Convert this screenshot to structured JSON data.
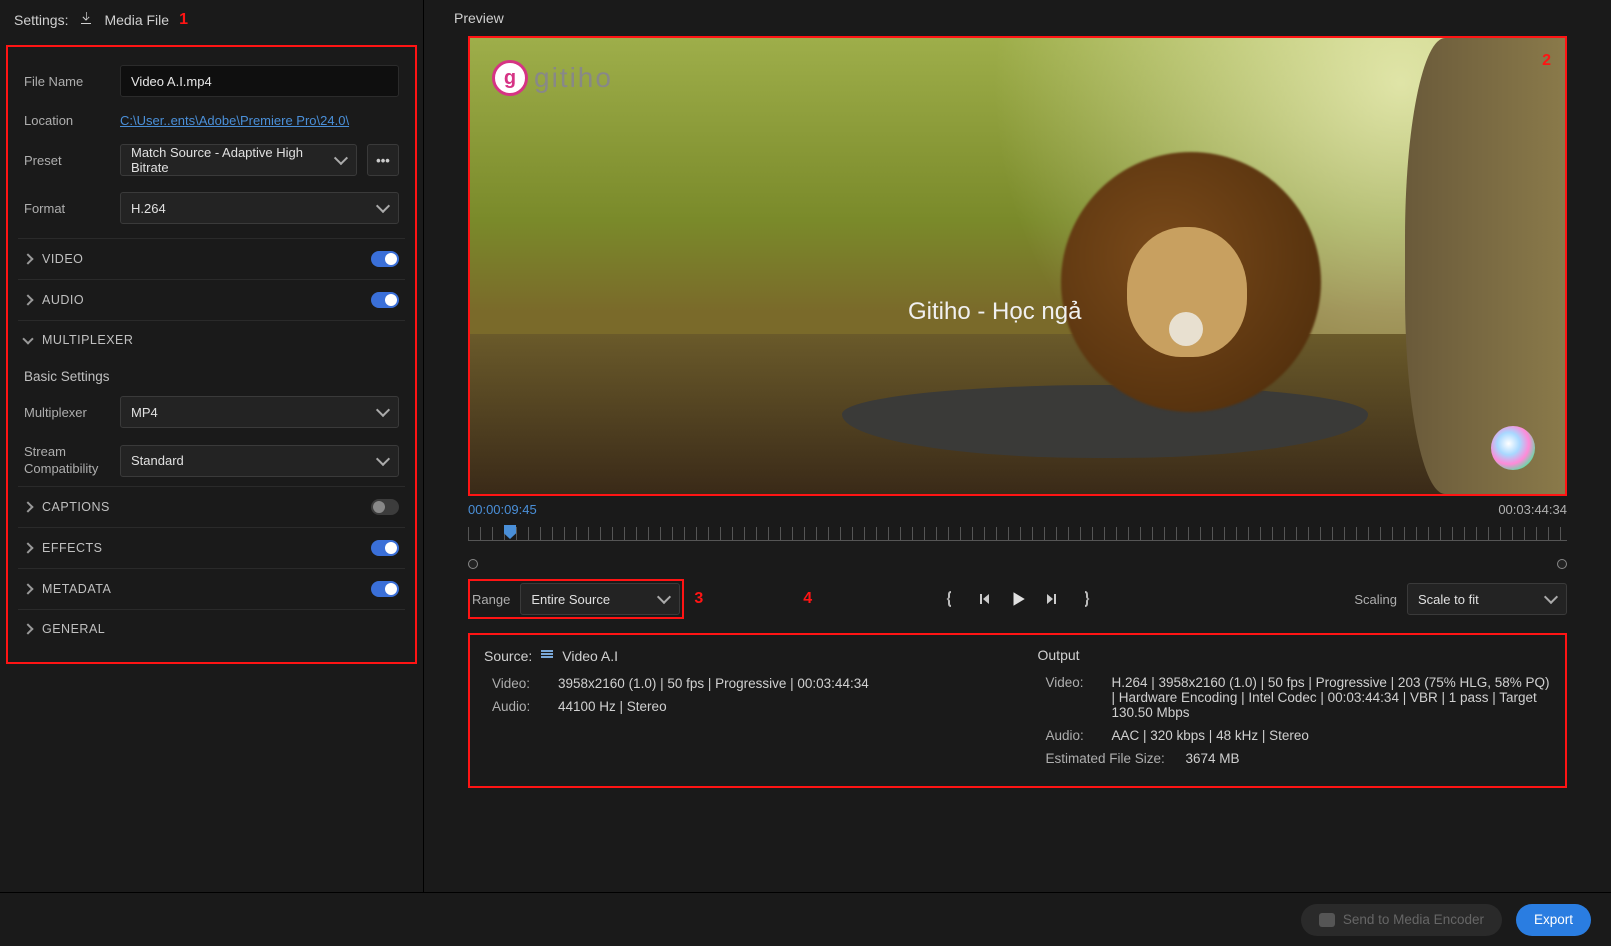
{
  "header": {
    "settings_label": "Settings:",
    "media_file_label": "Media File",
    "marker_1": "1"
  },
  "settings": {
    "file_name_label": "File Name",
    "file_name_value": "Video A.I.mp4",
    "location_label": "Location",
    "location_value": "C:\\User..ents\\Adobe\\Premiere Pro\\24.0\\",
    "preset_label": "Preset",
    "preset_value": "Match Source - Adaptive High Bitrate",
    "format_label": "Format",
    "format_value": "H.264",
    "sections": {
      "video": "VIDEO",
      "audio": "AUDIO",
      "multiplexer": "MULTIPLEXER",
      "captions": "CAPTIONS",
      "effects": "EFFECTS",
      "metadata": "METADATA",
      "general": "GENERAL"
    },
    "basic_settings_label": "Basic Settings",
    "multiplexer_field_label": "Multiplexer",
    "multiplexer_value": "MP4",
    "stream_compat_label": "Stream Compatibility",
    "stream_compat_value": "Standard"
  },
  "preview": {
    "header": "Preview",
    "marker_2": "2",
    "overlay_text": "Gitiho - Học ngả",
    "logo_text": "gitiho",
    "time_start": "00:00:09:45",
    "time_end": "00:03:44:34"
  },
  "controls": {
    "range_label": "Range",
    "range_value": "Entire Source",
    "marker_3": "3",
    "scaling_label": "Scaling",
    "scaling_value": "Scale to fit"
  },
  "summary": {
    "marker_4": "4",
    "source_label": "Source:",
    "source_name": "Video A.I",
    "source_video_label": "Video:",
    "source_video_value": "3958x2160 (1.0) | 50 fps | Progressive | 00:03:44:34",
    "source_audio_label": "Audio:",
    "source_audio_value": "44100 Hz | Stereo",
    "output_label": "Output",
    "output_video_label": "Video:",
    "output_video_value": "H.264 | 3958x2160 (1.0) | 50 fps | Progressive | 203 (75% HLG, 58% PQ) | Hardware Encoding | Intel Codec | 00:03:44:34 | VBR | 1 pass | Target 130.50 Mbps",
    "output_audio_label": "Audio:",
    "output_audio_value": "AAC | 320 kbps | 48 kHz | Stereo",
    "est_size_label": "Estimated File Size:",
    "est_size_value": "3674 MB"
  },
  "footer": {
    "send_label": "Send to Media Encoder",
    "export_label": "Export"
  }
}
